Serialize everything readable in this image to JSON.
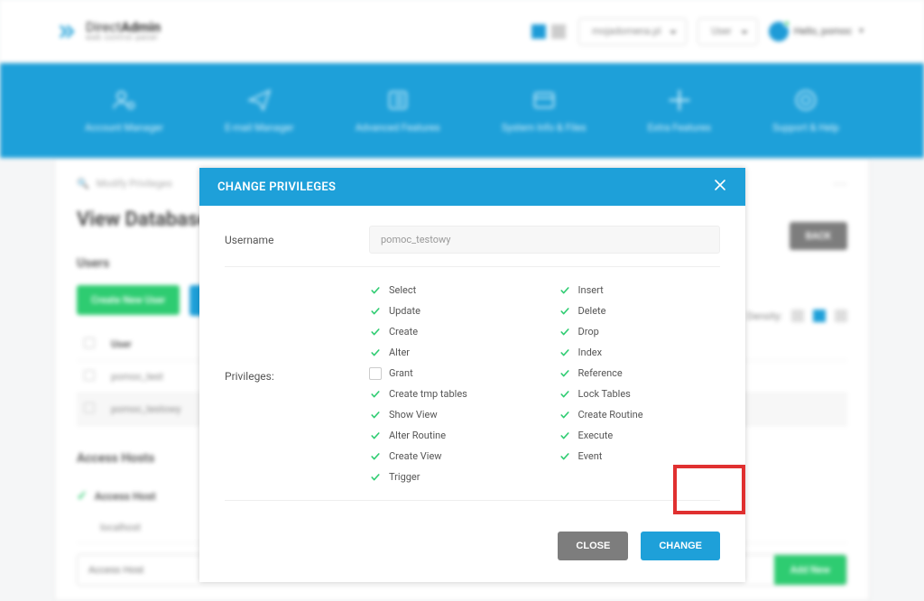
{
  "brand": {
    "line1a": "Direct",
    "line1b": "Admin",
    "line2": "web control panel"
  },
  "top": {
    "domain": "mojadomena.pl",
    "user_dropdown": "User",
    "hello": "Hello, pomoc"
  },
  "nav": [
    "Account Manager",
    "E-mail Manager",
    "Advanced Features",
    "System Info & Files",
    "Extra Features",
    "Support & Help"
  ],
  "breadcrumb": "Modify Privileges",
  "page_title": "View Database",
  "back": "BACK",
  "users_heading": "Users",
  "create_user": "Create New User",
  "density_label": "Density:",
  "table": {
    "header": "User",
    "rows": [
      "pomoc_test",
      "pomoc_testowy"
    ]
  },
  "hosts_heading": "Access Hosts",
  "hosts": {
    "header": "Access Host",
    "rows": [
      "localhost"
    ],
    "placeholder": "Access Host",
    "add": "Add New"
  },
  "modal": {
    "title": "CHANGE PRIVILEGES",
    "username_label": "Username",
    "username_value": "pomoc_testowy",
    "priv_label": "Privileges:",
    "col1": [
      {
        "label": "Select",
        "checked": true
      },
      {
        "label": "Update",
        "checked": true
      },
      {
        "label": "Create",
        "checked": true
      },
      {
        "label": "Alter",
        "checked": true
      },
      {
        "label": "Grant",
        "checked": false
      },
      {
        "label": "Create tmp tables",
        "checked": true
      },
      {
        "label": "Show View",
        "checked": true
      },
      {
        "label": "Alter Routine",
        "checked": true
      },
      {
        "label": "Create View",
        "checked": true
      },
      {
        "label": "Trigger",
        "checked": true
      }
    ],
    "col2": [
      {
        "label": "Insert",
        "checked": true
      },
      {
        "label": "Delete",
        "checked": true
      },
      {
        "label": "Drop",
        "checked": true
      },
      {
        "label": "Index",
        "checked": true
      },
      {
        "label": "Reference",
        "checked": true
      },
      {
        "label": "Lock Tables",
        "checked": true
      },
      {
        "label": "Create Routine",
        "checked": true
      },
      {
        "label": "Execute",
        "checked": true
      },
      {
        "label": "Event",
        "checked": true
      }
    ],
    "close": "CLOSE",
    "change": "CHANGE"
  }
}
